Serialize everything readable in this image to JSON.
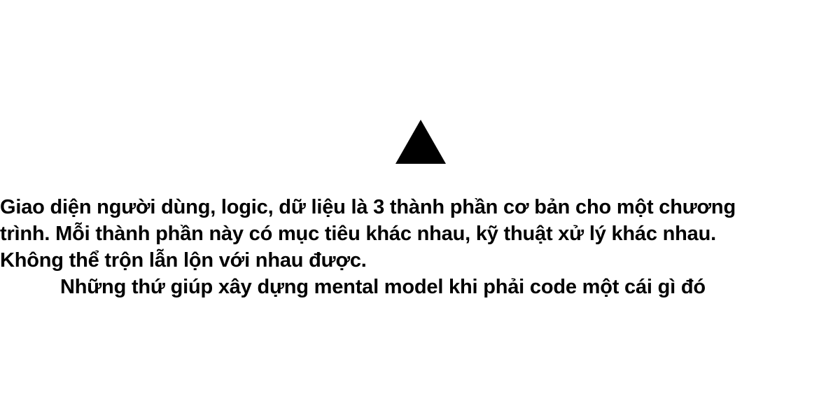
{
  "icon": "triangle-up-icon",
  "paragraph": {
    "line1": "Giao diện người dùng, logic, dữ liệu là 3 thành phần cơ bản cho một chương",
    "line2": "trình. Mỗi thành phần này có mục tiêu khác nhau, kỹ thuật xử lý khác nhau.",
    "line3": "Không thể trộn lẫn lộn với nhau được."
  },
  "subtitle": "Những thứ giúp xây dựng mental model khi phải code một cái gì đó"
}
